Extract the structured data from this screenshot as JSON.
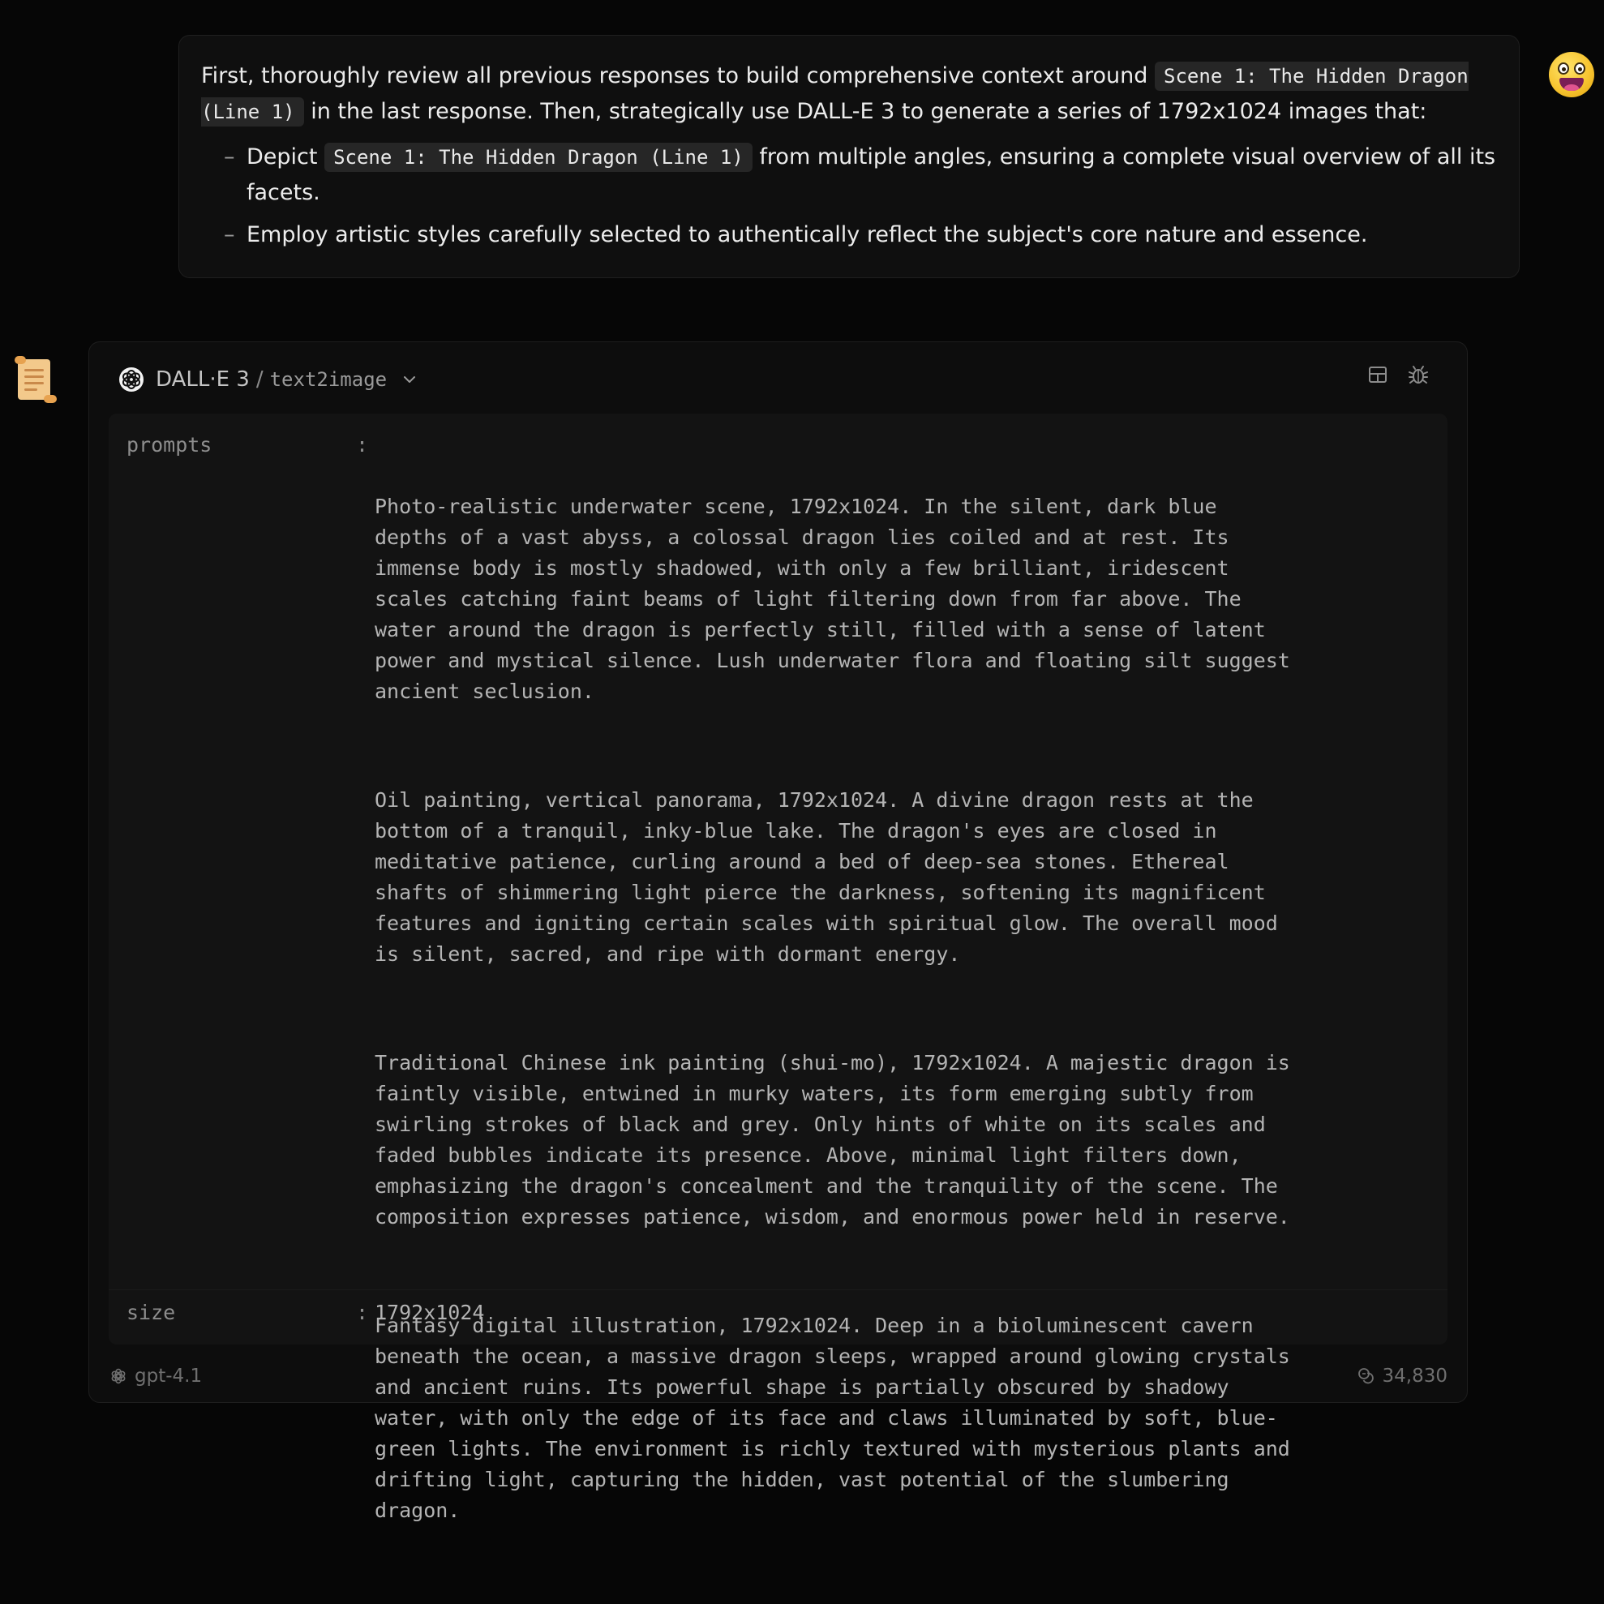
{
  "user_message": {
    "intro_before": "First, thoroughly review all previous responses to build comprehensive context around",
    "intro_code": "Scene 1: The Hidden Dragon (Line 1)",
    "intro_after": "in the last response. Then, strategically use DALL-E 3 to generate a series of 1792x1024 images that:",
    "bullets": [
      {
        "before": "Depict",
        "code": "Scene 1: The Hidden Dragon (Line 1)",
        "after": "from multiple angles, ensuring a complete visual overview of all its facets."
      },
      {
        "text": "Employ artistic styles carefully selected to authentically reflect the subject's core nature and essence."
      }
    ],
    "bullet_marker": "–"
  },
  "tool_call": {
    "tool_name": "DALL·E 3",
    "separator": "/",
    "method": "text2image",
    "args": {
      "prompts_key": "prompts",
      "size_key": "size",
      "colon": ":",
      "prompts": [
        "Photo-realistic underwater scene, 1792x1024. In the silent, dark blue\ndepths of a vast abyss, a colossal dragon lies coiled and at rest. Its\nimmense body is mostly shadowed, with only a few brilliant, iridescent\nscales catching faint beams of light filtering down from far above. The\nwater around the dragon is perfectly still, filled with a sense of latent\npower and mystical silence. Lush underwater flora and floating silt suggest\nancient seclusion.",
        "Oil painting, vertical panorama, 1792x1024. A divine dragon rests at the\nbottom of a tranquil, inky-blue lake. The dragon's eyes are closed in\nmeditative patience, curling around a bed of deep-sea stones. Ethereal\nshafts of shimmering light pierce the darkness, softening its magnificent\nfeatures and igniting certain scales with spiritual glow. The overall mood\nis silent, sacred, and ripe with dormant energy.",
        "Traditional Chinese ink painting (shui-mo), 1792x1024. A majestic dragon is\nfaintly visible, entwined in murky waters, its form emerging subtly from\nswirling strokes of black and grey. Only hints of white on its scales and\nfaded bubbles indicate its presence. Above, minimal light filters down,\nemphasizing the dragon's concealment and the tranquility of the scene. The\ncomposition expresses patience, wisdom, and enormous power held in reserve.",
        "Fantasy digital illustration, 1792x1024. Deep in a bioluminescent cavern\nbeneath the ocean, a massive dragon sleeps, wrapped around glowing crystals\nand ancient ruins. Its powerful shape is partially obscured by shadowy\nwater, with only the edge of its face and claws illuminated by soft, blue-\ngreen lights. The environment is richly textured with mysterious plants and\ndrifting light, capturing the hidden, vast potential of the slumbering\ndragon."
      ],
      "size": "1792x1024"
    },
    "footer": {
      "model": "gpt-4.1",
      "tokens": "34,830"
    }
  },
  "icons": {
    "user_avatar": "grinning-face-icon",
    "bot_avatar": "scroll-icon",
    "tool_logo": "openai-logo-icon",
    "dropdown": "chevron-down-icon",
    "layout": "layout-icon",
    "debug": "bug-icon",
    "tokens": "coins-icon"
  },
  "colors": {
    "background": "#060606",
    "bubble": "#0f0f0f",
    "card": "#0d0d0d",
    "args_panel": "#131313",
    "code_bg": "#262626"
  }
}
